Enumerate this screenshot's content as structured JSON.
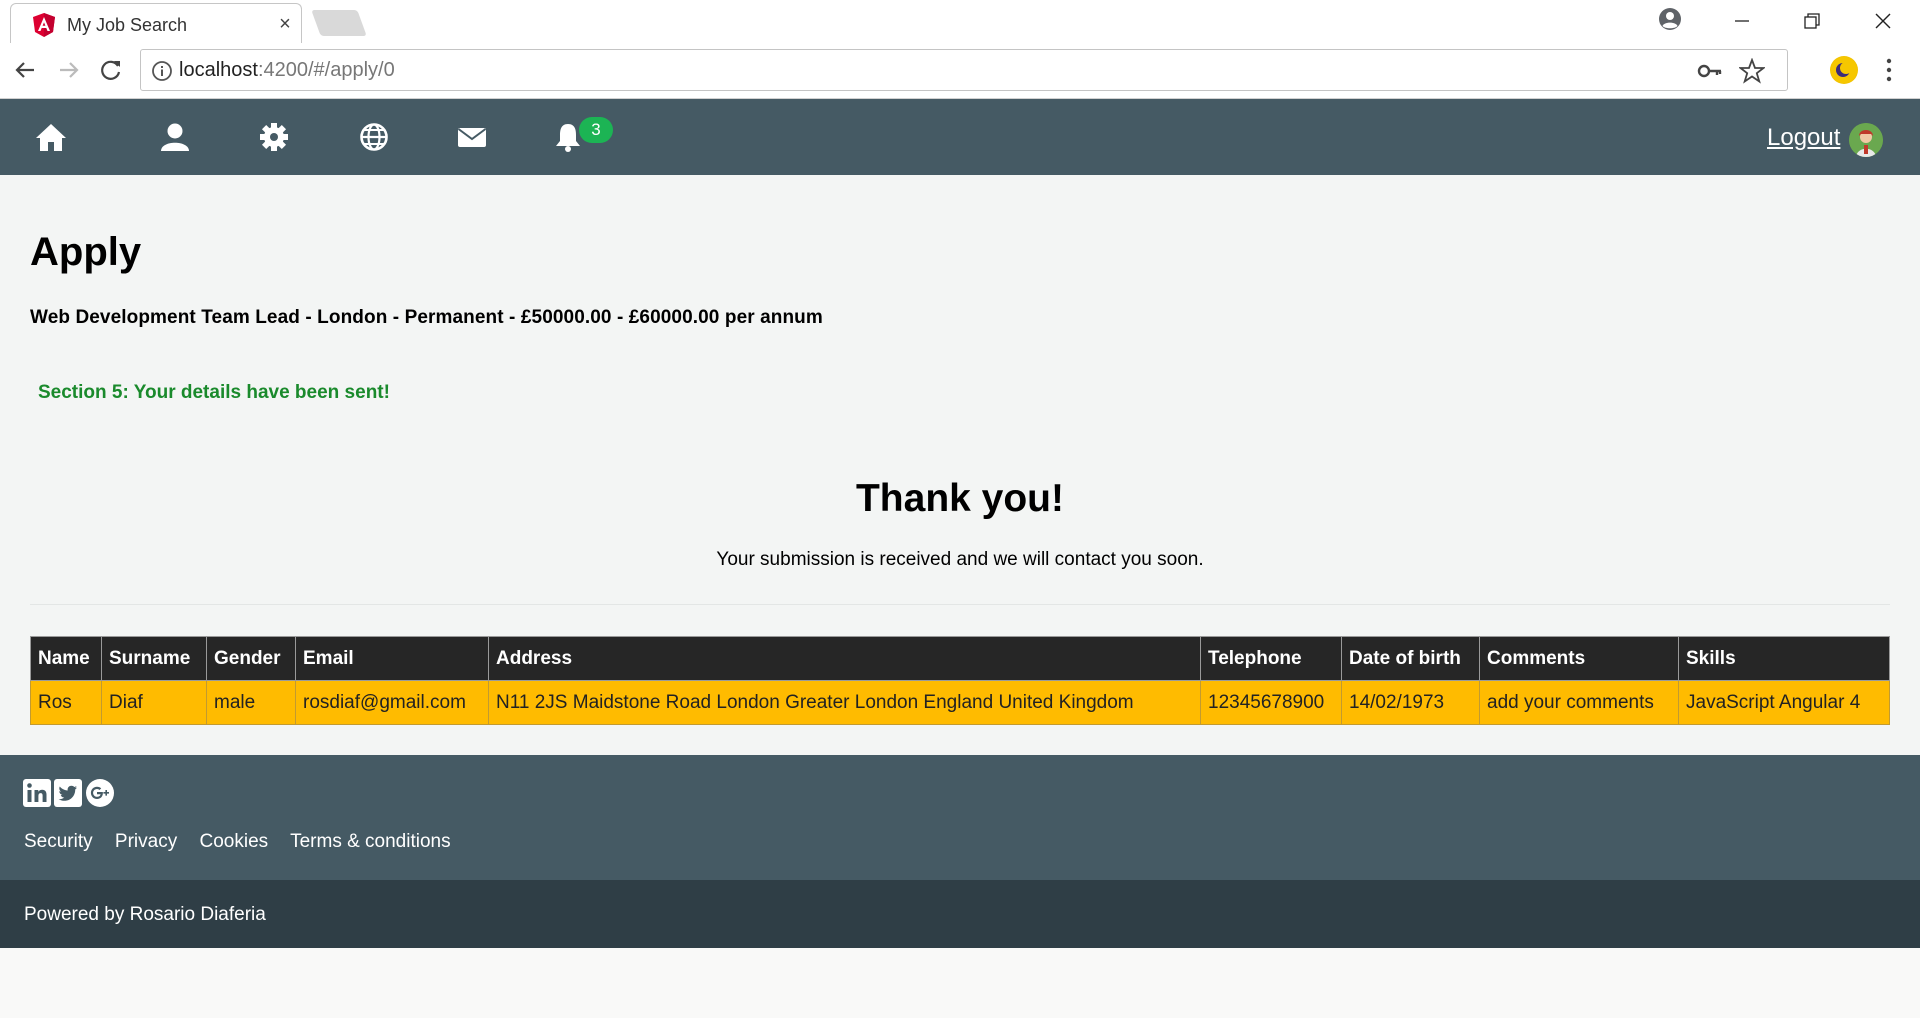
{
  "browser": {
    "tab_title": "My Job Search",
    "url_host": "localhost",
    "url_rest": ":4200/#/apply/0",
    "tab_close": "×"
  },
  "navbar": {
    "icons": [
      "home-icon",
      "user-icon",
      "gear-icon",
      "globe-icon",
      "envelope-icon",
      "bell-icon"
    ],
    "notification_count": "3",
    "logout_label": "Logout",
    "background": "#455a64"
  },
  "main": {
    "title": "Apply",
    "job_line": "Web Development Team Lead - London - Permanent - £50000.00 - £60000.00 per annum",
    "section_message": "Section 5: Your details have been sent!",
    "thanks_title": "Thank you!",
    "thanks_sub": "Your submission is received and we will contact you soon."
  },
  "table": {
    "headers": [
      "Name",
      "Surname",
      "Gender",
      "Email",
      "Address",
      "Telephone",
      "Date of birth",
      "Comments",
      "Skills"
    ],
    "rows": [
      [
        "Ros",
        "Diaf",
        "male",
        "rosdiaf@gmail.com",
        "N11 2JS Maidstone Road London Greater London England United Kingdom",
        "12345678900",
        "14/02/1973",
        "add your comments",
        "JavaScript Angular 4"
      ]
    ],
    "header_bg": "#262626",
    "row_bg": "#ffbb00"
  },
  "footer": {
    "social_icons": [
      "linkedin-icon",
      "twitter-icon",
      "google-plus-icon"
    ],
    "links": [
      "Security",
      "Privacy",
      "Cookies",
      "Terms & conditions"
    ],
    "powered_by": "Powered by Rosario Diaferia"
  },
  "colors": {
    "accent_green": "#1cb454",
    "success_text": "#1a8a2c",
    "footer_dark": "#2f3e46"
  }
}
